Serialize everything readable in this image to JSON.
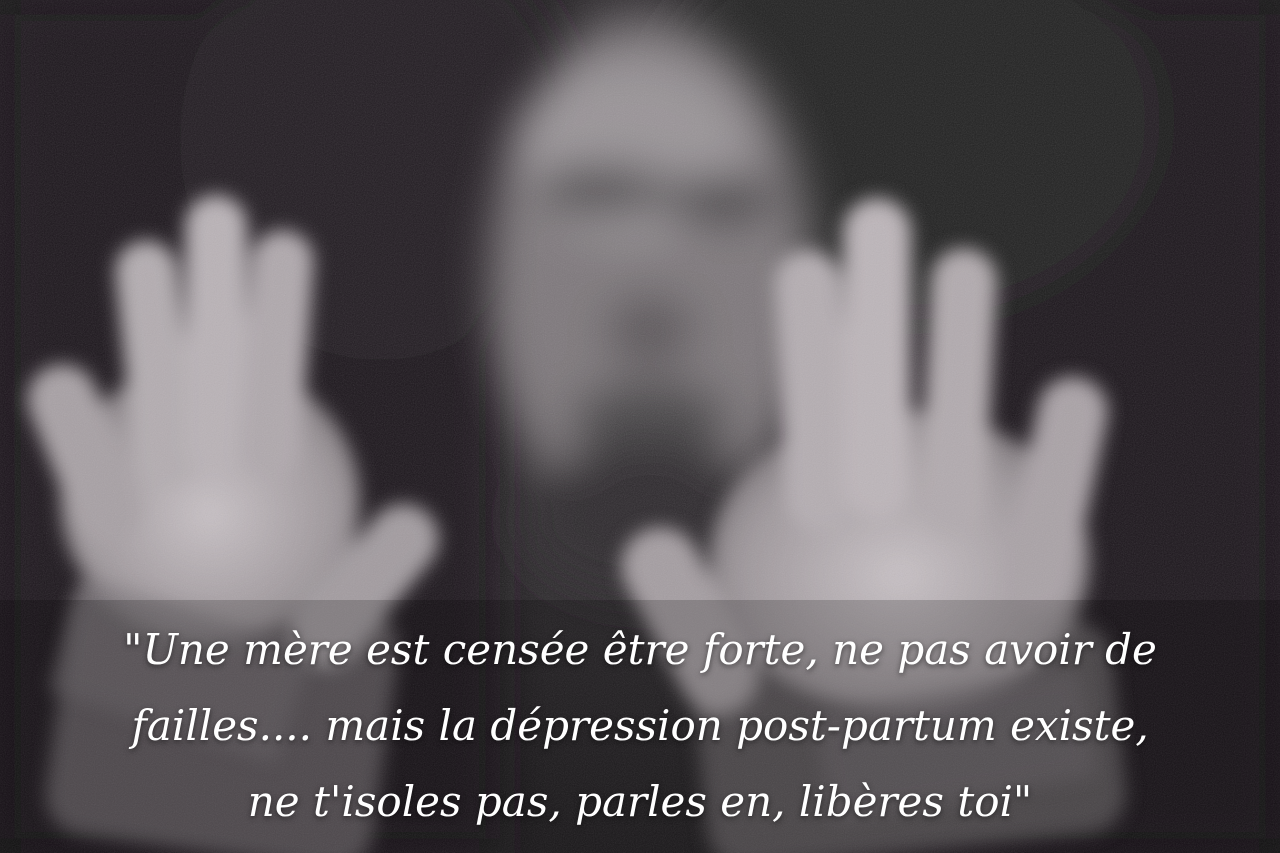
{
  "quote": {
    "lines": [
      "\"Une mère est censée être forte, ne pas avoir de",
      "failles.... mais la dépression post-partum existe,",
      "ne t'isoles pas, parles en, libères toi\""
    ]
  },
  "image": {
    "style": "black-and-white photograph",
    "subject": "blurred face and two hands pressed against foggy glass",
    "palette": {
      "background": "#141214",
      "skin": "#b8b0b4",
      "text": "#ffffff"
    }
  }
}
